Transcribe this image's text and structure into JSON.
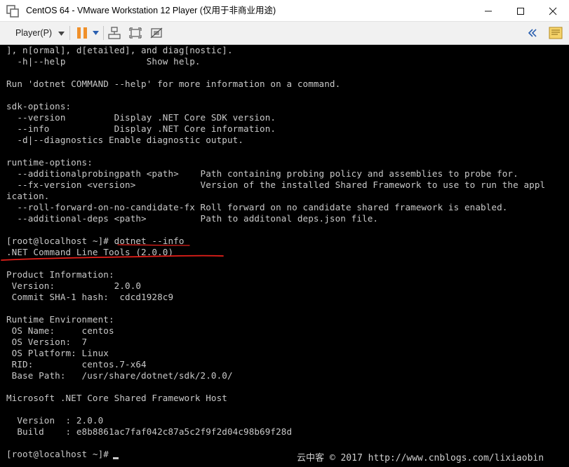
{
  "window": {
    "title": "CentOS 64 - VMware Workstation 12 Player (仅用于非商业用途)"
  },
  "toolbar": {
    "player_menu": "Player(P)",
    "icons": [
      "pause-icon",
      "dropdown-arrow-icon",
      "send-ctrl-alt-del-icon",
      "fit-window-icon",
      "unity-icon",
      "collapse-icon",
      "message-icon"
    ]
  },
  "terminal": {
    "lines": [
      "], n[ormal], d[etailed], and diag[nostic].",
      "  -h|--help               Show help.",
      "",
      "Run 'dotnet COMMAND --help' for more information on a command.",
      "",
      "sdk-options:",
      "  --version         Display .NET Core SDK version.",
      "  --info            Display .NET Core information.",
      "  -d|--diagnostics Enable diagnostic output.",
      "",
      "runtime-options:",
      "  --additionalprobingpath <path>    Path containing probing policy and assemblies to probe for.",
      "  --fx-version <version>            Version of the installed Shared Framework to use to run the appl",
      "ication.",
      "  --roll-forward-on-no-candidate-fx Roll forward on no candidate shared framework is enabled.",
      "  --additional-deps <path>          Path to additonal deps.json file.",
      "",
      "[root@localhost ~]# dotnet --info",
      ".NET Command Line Tools (2.0.0)",
      "",
      "Product Information:",
      " Version:           2.0.0",
      " Commit SHA-1 hash:  cdcd1928c9",
      "",
      "Runtime Environment:",
      " OS Name:     centos",
      " OS Version:  7",
      " OS Platform: Linux",
      " RID:         centos.7-x64",
      " Base Path:   /usr/share/dotnet/sdk/2.0.0/",
      "",
      "Microsoft .NET Core Shared Framework Host",
      "",
      "  Version  : 2.0.0",
      "  Build    : e8b8861ac7faf042c87a5c2f9f2d04c98b69f28d",
      "",
      "[root@localhost ~]# "
    ],
    "watermark": "云中客 © 2017 http://www.cnblogs.com/lixiaobin"
  },
  "colors": {
    "terminal_bg": "#000000",
    "terminal_fg": "#c9c9c9",
    "annotation": "#e8201a",
    "pause_orange": "#f0902a",
    "toolbar_blue": "#2a5fb0"
  }
}
